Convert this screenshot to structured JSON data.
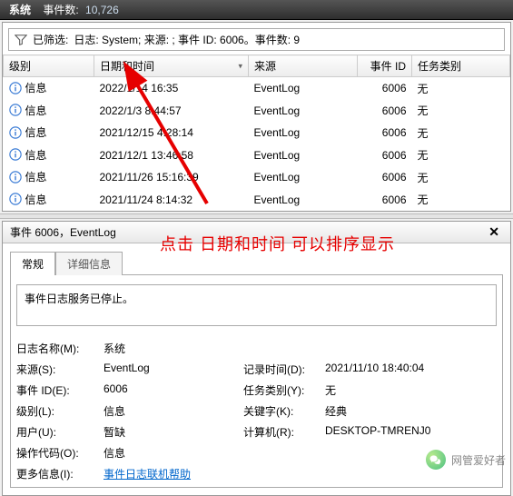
{
  "titlebar": {
    "title": "系统",
    "count_label": "事件数:",
    "count_value": "10,726"
  },
  "filter": {
    "label": "已筛选:",
    "text": "日志: System; 来源: ; 事件 ID: 6006。事件数: 9"
  },
  "columns": {
    "level": "级别",
    "datetime": "日期和时间",
    "source": "来源",
    "eventid": "事件 ID",
    "taskcat": "任务类别"
  },
  "level_info_label": "信息",
  "rows": [
    {
      "datetime": "2022/1/14      16:35",
      "source": "EventLog",
      "eventid": "6006",
      "taskcat": "无"
    },
    {
      "datetime": "2022/1/3 8:44:57",
      "source": "EventLog",
      "eventid": "6006",
      "taskcat": "无"
    },
    {
      "datetime": "2021/12/15 4:28:14",
      "source": "EventLog",
      "eventid": "6006",
      "taskcat": "无"
    },
    {
      "datetime": "2021/12/1 13:46:58",
      "source": "EventLog",
      "eventid": "6006",
      "taskcat": "无"
    },
    {
      "datetime": "2021/11/26 15:16:39",
      "source": "EventLog",
      "eventid": "6006",
      "taskcat": "无"
    },
    {
      "datetime": "2021/11/24 8:14:32",
      "source": "EventLog",
      "eventid": "6006",
      "taskcat": "无"
    }
  ],
  "detail": {
    "title": "事件 6006，EventLog",
    "tabs": {
      "general": "常规",
      "details": "详细信息"
    },
    "message": "事件日志服务已停止。",
    "labels": {
      "logname": "日志名称(M):",
      "source": "来源(S):",
      "eventid": "事件 ID(E):",
      "level": "级别(L):",
      "user": "用户(U):",
      "opcode": "操作代码(O):",
      "more": "更多信息(I):",
      "logged": "记录时间(D):",
      "taskcat": "任务类别(Y):",
      "keywords": "关键字(K):",
      "computer": "计算机(R):"
    },
    "values": {
      "logname": "系统",
      "source": "EventLog",
      "eventid": "6006",
      "level": "信息",
      "user": "暂缺",
      "opcode": "信息",
      "more_link": "事件日志联机帮助",
      "logged": "2021/11/10 18:40:04",
      "taskcat": "无",
      "keywords": "经典",
      "computer": "DESKTOP-TMRENJ0"
    }
  },
  "annotation": "点击 日期和时间 可以排序显示",
  "watermark": "网管爱好者"
}
